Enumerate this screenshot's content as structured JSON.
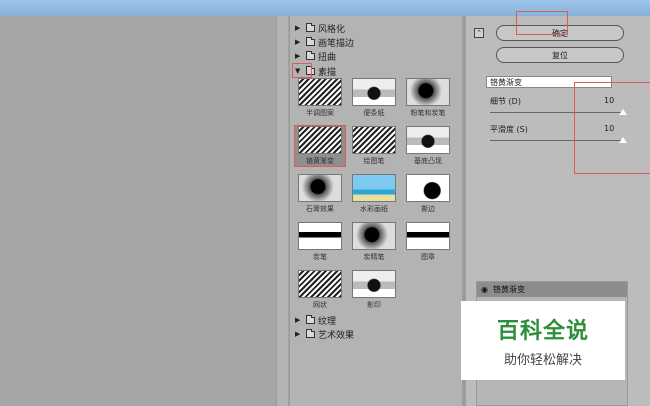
{
  "dialog": {
    "title_bar": ""
  },
  "gallery": {
    "categories_top": [
      {
        "label": "风格化",
        "expanded": false
      },
      {
        "label": "画笔描边",
        "expanded": false
      },
      {
        "label": "扭曲",
        "expanded": false
      },
      {
        "label": "素描",
        "expanded": true
      }
    ],
    "thumbnails": [
      {
        "label": "半调图案"
      },
      {
        "label": "便条纸"
      },
      {
        "label": "粉笔和炭笔"
      },
      {
        "label": "铬黄渐变",
        "selected": true
      },
      {
        "label": "绘图笔"
      },
      {
        "label": "基底凸现"
      },
      {
        "label": "石膏效果"
      },
      {
        "label": "水彩画纸"
      },
      {
        "label": "撕边"
      },
      {
        "label": "炭笔"
      },
      {
        "label": "炭精笔"
      },
      {
        "label": "图章"
      },
      {
        "label": "网状"
      },
      {
        "label": "影印"
      }
    ],
    "categories_bottom": [
      {
        "label": "纹理",
        "expanded": false
      },
      {
        "label": "艺术效果",
        "expanded": false
      }
    ]
  },
  "settings": {
    "collapse_icon": "chevron-up-icon",
    "ok_label": "确定",
    "reset_label": "复位",
    "filter_select": "铬黄渐变",
    "params": [
      {
        "label": "细节 (D)",
        "value": "10",
        "fraction": 1.0
      },
      {
        "label": "平滑度 (S)",
        "value": "10",
        "fraction": 1.0
      }
    ]
  },
  "layers": {
    "eye_icon": "eye-icon",
    "active_layer": "铬黄渐变"
  },
  "watermark": {
    "title": "百科全说",
    "subtitle": "助你轻松解决"
  },
  "colors": {
    "highlight_box": "#e05a5a",
    "watermark_green": "#2c8f3a"
  }
}
